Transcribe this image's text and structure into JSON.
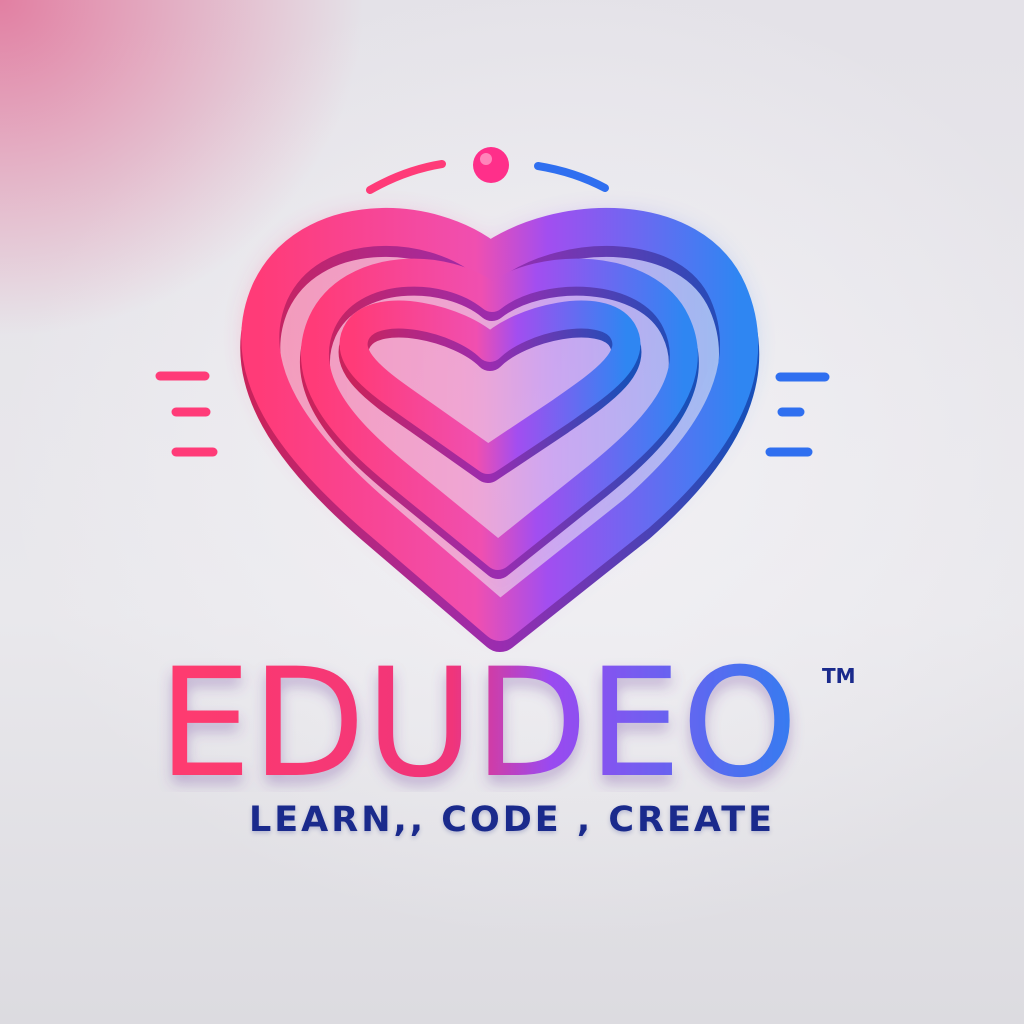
{
  "brand": {
    "name": "EDUDEO",
    "trademark": "TM",
    "tagline": "LEARN,, CODE , CREATE",
    "icon": "layered-heart-icon"
  },
  "colors": {
    "pink": "#ff3d7a",
    "magenta": "#d64bd6",
    "purple": "#8a4bf0",
    "blue": "#2f7ff0",
    "tagline": "#1a2a8c",
    "background": "#e7e6eb"
  }
}
